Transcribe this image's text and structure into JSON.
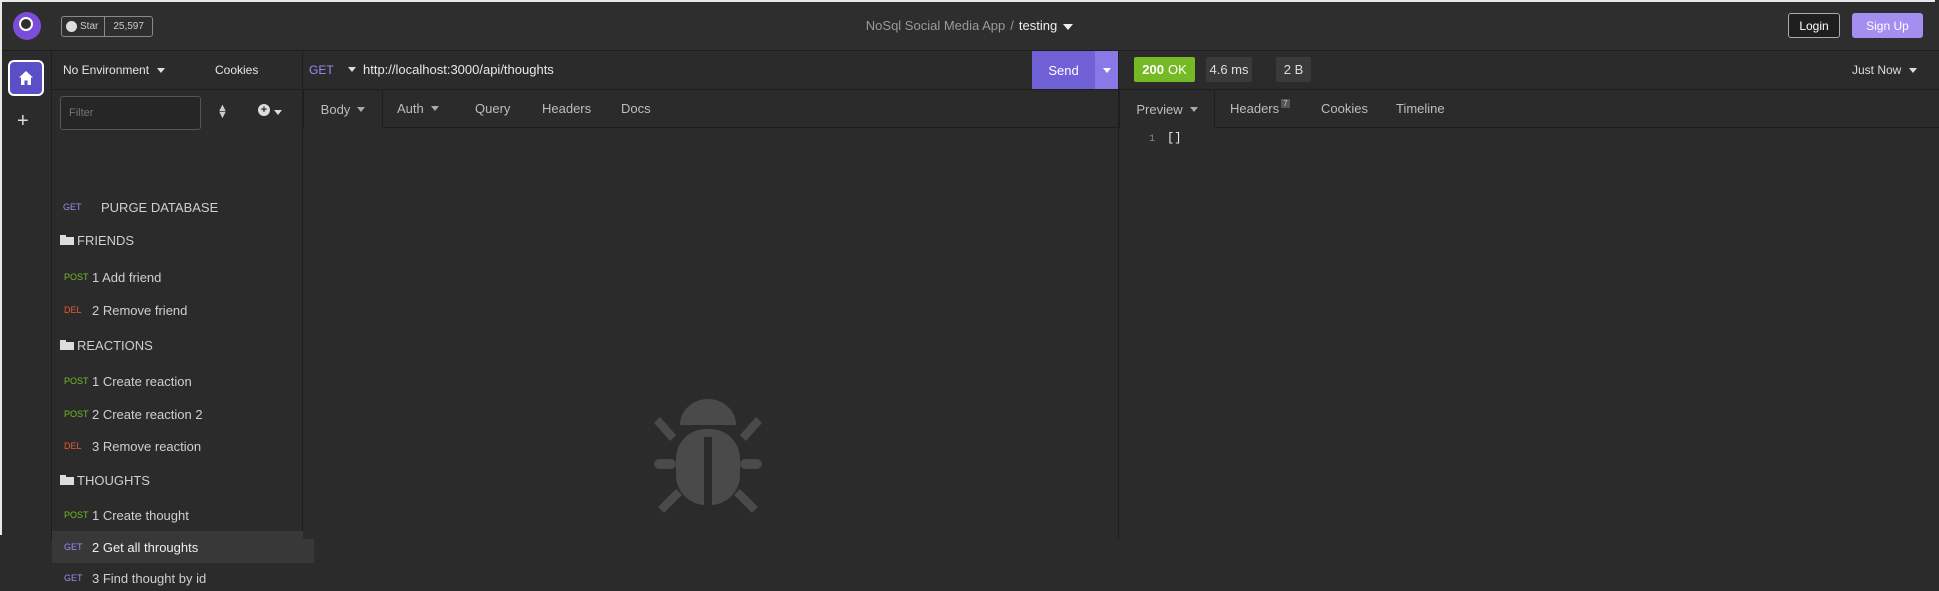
{
  "topbar": {
    "github_star_label": "Star",
    "github_star_count": "25,597",
    "project_name": "NoSql Social Media App",
    "separator": "/",
    "workspace_name": "testing",
    "login_label": "Login",
    "signup_label": "Sign Up"
  },
  "rail": {
    "add_label": "+"
  },
  "sidebar": {
    "environment": "No Environment",
    "cookies_label": "Cookies",
    "filter_placeholder": "Filter",
    "items": [
      {
        "type": "request",
        "method": "GET",
        "label": "PURGE DATABASE"
      },
      {
        "type": "folder",
        "label": "FRIENDS"
      },
      {
        "type": "request",
        "method": "POST",
        "label": "1 Add friend"
      },
      {
        "type": "request",
        "method": "DEL",
        "label": "2 Remove friend"
      },
      {
        "type": "folder",
        "label": "REACTIONS"
      },
      {
        "type": "request",
        "method": "POST",
        "label": "1 Create reaction"
      },
      {
        "type": "request",
        "method": "POST",
        "label": "2 Create reaction 2"
      },
      {
        "type": "request",
        "method": "DEL",
        "label": "3 Remove reaction"
      },
      {
        "type": "folder",
        "label": "THOUGHTS"
      },
      {
        "type": "request",
        "method": "POST",
        "label": "1 Create thought"
      },
      {
        "type": "request",
        "method": "GET",
        "label": "2 Get all throughts",
        "active": true
      },
      {
        "type": "request",
        "method": "GET",
        "label": "3 Find thought by id"
      }
    ]
  },
  "request": {
    "method": "GET",
    "url": "http://localhost:3000/api/thoughts",
    "send_label": "Send",
    "tabs": [
      "Body",
      "Auth",
      "Query",
      "Headers",
      "Docs"
    ]
  },
  "response": {
    "status_code": "200",
    "status_text": "OK",
    "time": "4.6 ms",
    "size": "2 B",
    "timestamp": "Just Now",
    "tabs": [
      "Preview",
      "Headers",
      "Cookies",
      "Timeline"
    ],
    "headers_count": "7",
    "line_number": "1",
    "body": "[]"
  },
  "colors": {
    "accent": "#6f60d6",
    "signup": "#a48ff0",
    "get": "#9b8df0",
    "post": "#75ba24",
    "delete": "#ec5a3c",
    "status_ok": "#75ba24"
  }
}
